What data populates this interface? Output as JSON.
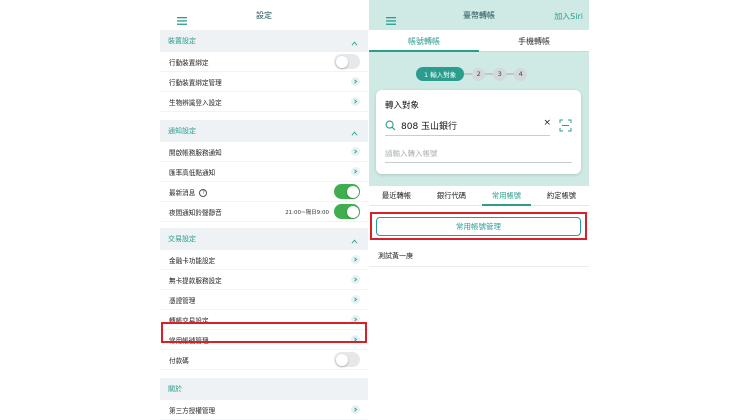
{
  "left": {
    "title": "設定",
    "sections": [
      {
        "label": "裝置設定",
        "rows": [
          {
            "label": "行動裝置綁定",
            "control": "toggle-off"
          },
          {
            "label": "行動裝置綁定管理",
            "control": "arrow"
          },
          {
            "label": "生物辨識登入設定",
            "control": "arrow"
          }
        ]
      },
      {
        "label": "通知設定",
        "rows": [
          {
            "label": "開啟帳務服務通知",
            "control": "arrow"
          },
          {
            "label": "匯率高低點通知",
            "control": "arrow"
          },
          {
            "label": "最新消息",
            "control": "toggle-on",
            "help": "?"
          },
          {
            "label": "夜間通知鈴聲靜音",
            "control": "toggle-on",
            "time": "21:00~隔日9:00"
          }
        ]
      },
      {
        "label": "交易設定",
        "rows": [
          {
            "label": "金融卡功能設定",
            "control": "arrow"
          },
          {
            "label": "無卡提款服務設定",
            "control": "arrow"
          },
          {
            "label": "憑證管理",
            "control": "arrow"
          },
          {
            "label": "轉帳交易設定",
            "control": "arrow"
          },
          {
            "label": "常用帳號管理",
            "control": "arrow"
          },
          {
            "label": "付款碼",
            "control": "toggle-off"
          }
        ]
      },
      {
        "label": "關於",
        "rows": [
          {
            "label": "第三方授權管理",
            "control": "arrow"
          }
        ]
      }
    ]
  },
  "right": {
    "title": "臺幣轉帳",
    "siri_label": "加入Siri",
    "tabs": [
      "帳號轉帳",
      "手機轉帳"
    ],
    "steps": [
      "1 輸入對象",
      "2",
      "3",
      "4"
    ],
    "card": {
      "title": "轉入對象",
      "bank_value": "808 玉山銀行",
      "clear_glyph": "×",
      "account_placeholder": "請輸入轉入帳號"
    },
    "subtabs": [
      "最近轉帳",
      "銀行代碼",
      "常用帳號",
      "約定帳號"
    ],
    "manage_button": "常用帳號管理",
    "accounts": [
      "測試黃一庚"
    ]
  },
  "colors": {
    "accent": "#2a9d8f",
    "toggle_on": "#3fae4e",
    "highlight": "#d9202a",
    "header_band": "#cfe9e4"
  },
  "icons": [
    "menu-icon",
    "chevron-up-icon",
    "chevron-right-icon",
    "search-icon",
    "scan-icon",
    "help-icon"
  ]
}
